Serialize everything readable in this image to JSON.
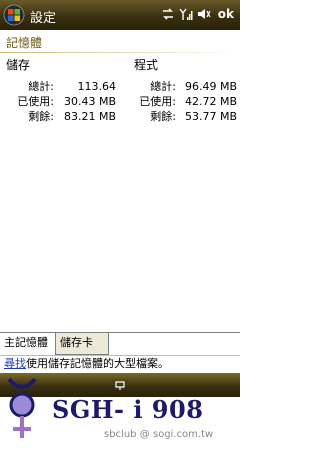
{
  "titlebar": {
    "title": "設定",
    "ok": "ok"
  },
  "header": {
    "title": "記憶體"
  },
  "storage": {
    "heading": "儲存",
    "rows": [
      {
        "label": "總計:",
        "value": "113.64"
      },
      {
        "label": "已使用:",
        "value": "30.43 MB"
      },
      {
        "label": "剩餘:",
        "value": "83.21 MB"
      }
    ]
  },
  "program": {
    "heading": "程式",
    "rows": [
      {
        "label": "總計:",
        "value": "96.49 MB"
      },
      {
        "label": "已使用:",
        "value": "42.72 MB"
      },
      {
        "label": "剩餘:",
        "value": "53.77 MB"
      }
    ]
  },
  "tabs": [
    {
      "label": "主記憶體"
    },
    {
      "label": "儲存卡"
    }
  ],
  "hint": {
    "link": "尋找",
    "text": "使用儲存記憶體的大型檔案。"
  },
  "watermark": {
    "brand": "SGH- i 908",
    "credit": "sbclub @ sogi.com.tw"
  },
  "icons": {
    "start": "windows-start-icon",
    "sync": "sync-icon",
    "signal": "signal-icon",
    "volume": "volume-icon",
    "keyboard": "keyboard-icon"
  }
}
